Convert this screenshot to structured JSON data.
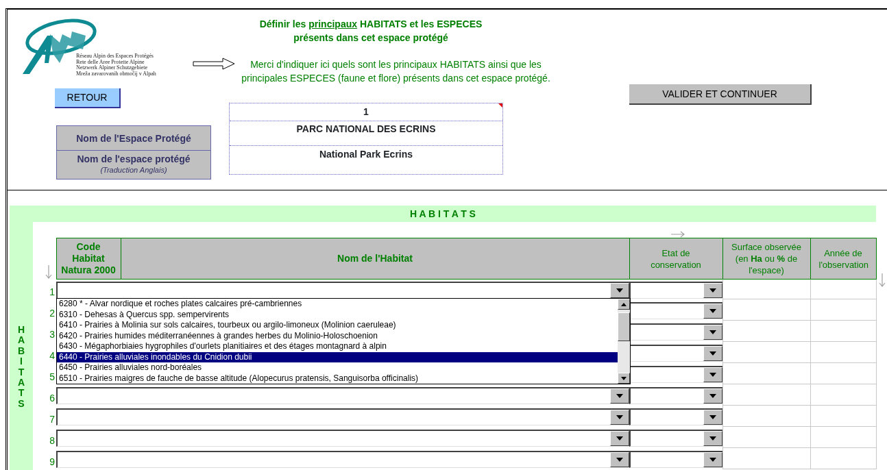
{
  "header": {
    "logo_lines": [
      "Réseau Alpin des Espaces Protégés",
      "Rete delle Aree Protette Alpine",
      "Netzwerk Alpiner Schutzgebiete",
      "Mreža zavarovanih območij v Alpah"
    ],
    "title_line1": [
      {
        "text": "Définir les ",
        "underline": false
      },
      {
        "text": "principaux",
        "underline": true
      },
      {
        "text": " HABITATS et les ESPECES",
        "underline": false
      }
    ],
    "title_line2": "présents dans cet espace protégé",
    "instructions": "Merci d'indiquer ici quels sont les principaux HABITATS ainsi que les principales ESPECES (faune et flore) présents dans cet espace protégé.",
    "back_button": "RETOUR",
    "validate_button": "VALIDER ET CONTINUER",
    "labels": [
      {
        "text": "Nom de l'Espace Protégé"
      },
      {
        "text": "Nom de l'espace protégé",
        "note": "(Traduction Anglais)"
      }
    ],
    "name_table": {
      "number": "1",
      "has_comment": true,
      "name_fr": "PARC NATIONAL DES ECRINS",
      "name_en": "National Park Ecrins"
    }
  },
  "habitats": {
    "band_title": "H A B I T A T S",
    "side_title": "HABITATS",
    "columns": [
      {
        "label": "Code Habitat Natura 2000"
      },
      {
        "label": "Nom de l'Habitat"
      },
      {
        "label": "Etat de conservation"
      },
      {
        "label": "Surface observée (en **Ha** ou **%** de l'espace)"
      },
      {
        "label": "Année de l'observation"
      }
    ],
    "rows": [
      {
        "number": "1"
      },
      {
        "number": "2"
      },
      {
        "number": "3"
      },
      {
        "number": "4"
      },
      {
        "number": "5"
      },
      {
        "number": "6"
      },
      {
        "number": "7"
      },
      {
        "number": "8"
      },
      {
        "number": "9"
      }
    ],
    "dropdown_options": [
      {
        "text": "6280 * - Alvar nordique et roches plates calcaires pré-cambriennes",
        "selected": false
      },
      {
        "text": "6310 - Dehesas à Quercus spp. sempervirents",
        "selected": false
      },
      {
        "text": "6410 - Prairies à Molinia sur sols calcaires, tourbeux ou argilo-limoneux (Molinion caeruleae)",
        "selected": false
      },
      {
        "text": "6420 - Prairies humides méditerranéennes à grandes herbes du Molinio-Holoschoenion",
        "selected": false
      },
      {
        "text": "6430 - Mégaphorbiaies hygrophiles d'ourlets planitiaires et des étages montagnard à alpin",
        "selected": false
      },
      {
        "text": "6440 - Prairies alluviales inondables du Cnidion dubii",
        "selected": true
      },
      {
        "text": "6450 - Prairies alluviales nord-boréales",
        "selected": false
      },
      {
        "text": "6510 - Prairies maigres de fauche de basse altitude (Alopecurus pratensis, Sanguisorba officinalis)",
        "selected": false
      }
    ]
  }
}
